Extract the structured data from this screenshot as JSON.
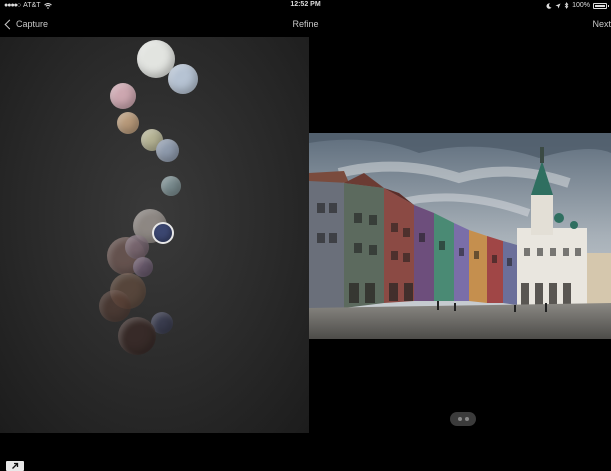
{
  "status": {
    "carrier": "AT&T",
    "time": "12:52 PM",
    "battery": "100%"
  },
  "nav": {
    "back_label": "Capture",
    "title": "Refine",
    "next_label": "Next"
  },
  "colors": {
    "panel": "#2a2a2a",
    "swatches": [
      "#e2e4e0",
      "#b6c3d3",
      "#cda7b0",
      "#b89a7a",
      "#b5b394",
      "#8f9bad",
      "#7a8c8f",
      "#9c9590",
      "#7a6873",
      "#715a55",
      "#6e5d72",
      "#6a5040",
      "#5a3f35",
      "#4e3a32",
      "#3c3f56",
      "#392a27"
    ],
    "selected_swatch": "#3b4670"
  },
  "photo": {
    "subject": "colorful-town-square-buildings"
  }
}
